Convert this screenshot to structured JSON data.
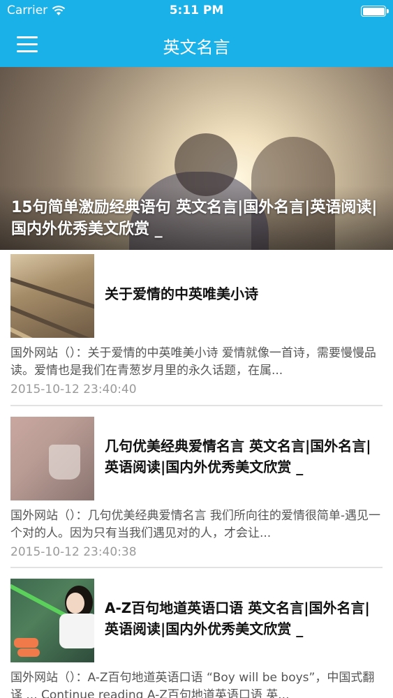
{
  "status_bar": {
    "carrier": "Carrier",
    "time": "5:11 PM"
  },
  "nav": {
    "title": "英文名言",
    "menu_icon": "hamburger-menu-icon"
  },
  "hero": {
    "title": "15句简单激励经典语句  英文名言|国外名言|英语阅读|国内外优秀美文欣赏 _"
  },
  "articles": [
    {
      "title": "关于爱情的中英唯美小诗",
      "summary": "国外网站（）：关于爱情的中英唯美小诗 爱情就像一首诗，需要慢慢品读。爱情也是我们在青葱岁月里的永久话题，在属...",
      "date": "2015-10-12 23:40:40"
    },
    {
      "title": "几句优美经典爱情名言  英文名言|国外名言|英语阅读|国内外优秀美文欣赏 _",
      "summary": "国外网站（）：几句优美经典爱情名言 我们所向往的爱情很简单-遇见一个对的人。因为只有当我们遇见对的人，才会让...",
      "date": "2015-10-12 23:40:38"
    },
    {
      "title": "A-Z百句地道英语口语  英文名言|国外名言|英语阅读|国内外优秀美文欣赏 _",
      "summary": "国外网站（）：A-Z百句地道英语口语 “Boy will be boys”，中国式翻译 ... Continue reading A-Z百句地道英语口语 英..."
    }
  ],
  "colors": {
    "accent": "#1ab0e8",
    "date": "#9a9a9a"
  }
}
